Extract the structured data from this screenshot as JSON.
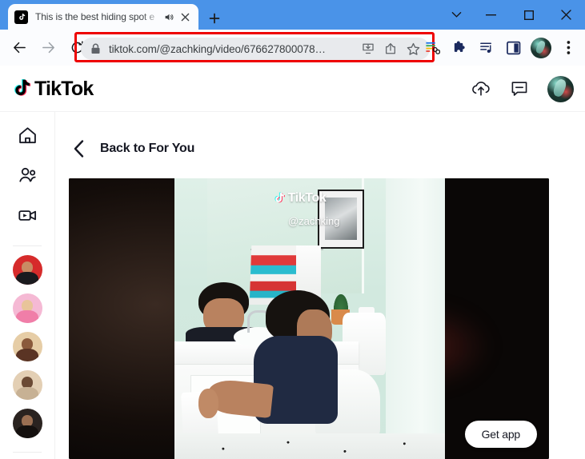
{
  "browser": {
    "titlebar_color": "#4a93e8",
    "tab": {
      "title": "This is the best hiding spot e",
      "favicon_name": "tiktok-favicon",
      "audio_icon": "speaker-playing-icon",
      "close_icon": "close-icon"
    },
    "new_tab_label": "+",
    "window_controls": {
      "search_tabs": "tab-search-chevron",
      "minimize": "minimize",
      "maximize": "maximize",
      "close": "close"
    },
    "nav": {
      "back": "back-arrow",
      "forward": "forward-arrow",
      "reload": "reload-arrow"
    },
    "omnibox": {
      "lock_icon": "lock-icon",
      "url": "tiktok.com/@zachking/video/676627800078…",
      "install_icon": "install-app-icon",
      "share_icon": "share-icon",
      "bookmark_icon": "star-icon",
      "highlight_color": "#ee0000"
    },
    "toolbar_icons": [
      {
        "name": "reading-list-icon"
      },
      {
        "name": "extensions-puzzle-icon"
      },
      {
        "name": "media-playlist-icon"
      },
      {
        "name": "side-panel-icon"
      }
    ],
    "profile_avatar_name": "chrome-profile-avatar",
    "menu_icon": "three-dot-menu-icon"
  },
  "tiktok": {
    "logo_text": "TikTok",
    "header_icons": [
      {
        "name": "upload-cloud-icon"
      },
      {
        "name": "inbox-message-icon"
      }
    ],
    "header_avatar_name": "tiktok-profile-avatar",
    "sidebar": {
      "items": [
        {
          "name": "sidebar-item-for-you",
          "icon": "home-icon"
        },
        {
          "name": "sidebar-item-following",
          "icon": "people-icon"
        },
        {
          "name": "sidebar-item-live",
          "icon": "live-video-icon"
        }
      ],
      "suggested_accounts": [
        {
          "name": "sidebar-avatar-1",
          "bg": "#d62b2b",
          "head": "#c98b63",
          "body": "#1a1a1e"
        },
        {
          "name": "sidebar-avatar-2",
          "bg": "#f5b9d4",
          "head": "#e8c49a",
          "body": "#f07ea8"
        },
        {
          "name": "sidebar-avatar-3",
          "bg": "#e6cda6",
          "head": "#8a5a3c",
          "body": "#5a3424"
        },
        {
          "name": "sidebar-avatar-4",
          "bg": "#e3cfb4",
          "head": "#6b4a34",
          "body": "#c7b194"
        },
        {
          "name": "sidebar-avatar-5",
          "bg": "#2a2320",
          "head": "#9a6f52",
          "body": "#14100e"
        }
      ]
    },
    "back_link": {
      "label": "Back to For You",
      "icon": "chevron-left-icon"
    },
    "video": {
      "watermark_text": "TikTok",
      "username": "@zachking"
    },
    "get_app_label": "Get app"
  }
}
